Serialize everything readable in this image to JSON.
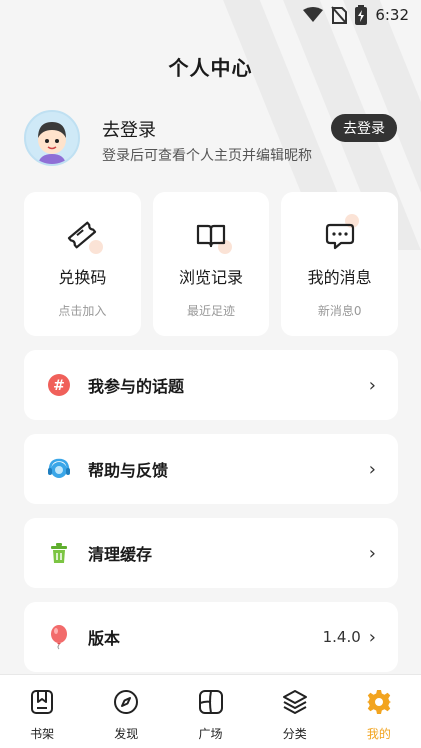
{
  "status_bar": {
    "time": "6:32"
  },
  "page": {
    "title": "个人中心"
  },
  "profile": {
    "name": "去登录",
    "subtitle": "登录后可查看个人主页并编辑昵称",
    "login_button": "去登录"
  },
  "quick_cards": [
    {
      "title": "兑换码",
      "subtitle": "点击加入",
      "icon": "ticket-icon"
    },
    {
      "title": "浏览记录",
      "subtitle": "最近足迹",
      "icon": "book-icon"
    },
    {
      "title": "我的消息",
      "subtitle": "新消息0",
      "icon": "message-icon"
    }
  ],
  "menu": [
    {
      "label": "我参与的话题",
      "icon": "hashtag-icon",
      "value": ""
    },
    {
      "label": "帮助与反馈",
      "icon": "headset-icon",
      "value": ""
    },
    {
      "label": "清理缓存",
      "icon": "trash-icon",
      "value": ""
    },
    {
      "label": "版本",
      "icon": "balloon-icon",
      "value": "1.4.0"
    }
  ],
  "tabs": [
    {
      "label": "书架",
      "icon": "bookshelf-icon",
      "active": false
    },
    {
      "label": "发现",
      "icon": "compass-icon",
      "active": false
    },
    {
      "label": "广场",
      "icon": "square-grid-icon",
      "active": false
    },
    {
      "label": "分类",
      "icon": "layers-icon",
      "active": false
    },
    {
      "label": "我的",
      "icon": "gear-icon",
      "active": true
    }
  ],
  "colors": {
    "accent": "#f2a41f",
    "background": "#f5f5f5",
    "button_dark": "#333333"
  }
}
